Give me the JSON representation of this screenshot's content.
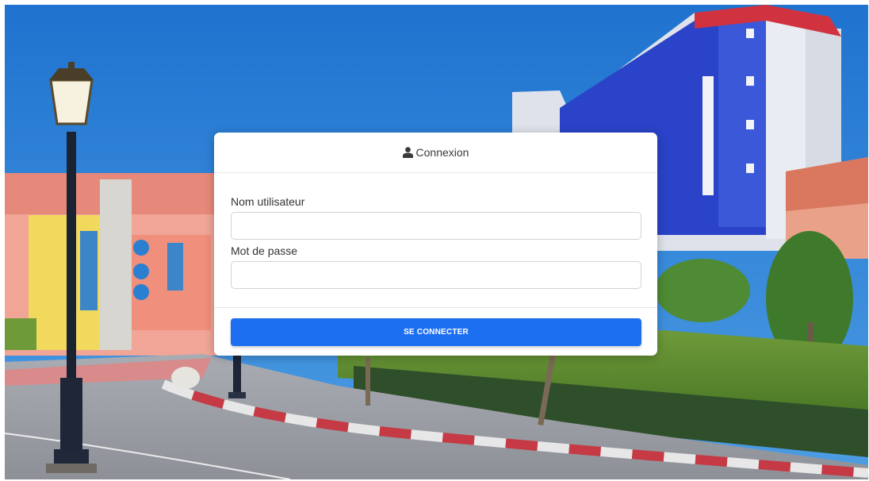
{
  "login": {
    "title": "Connexion",
    "title_icon": "user-icon",
    "username_label": "Nom utilisateur",
    "username_value": "",
    "password_label": "Mot de passe",
    "password_value": "",
    "submit_label": "SE CONNECTER"
  },
  "colors": {
    "primary_button": "#1d6ff2",
    "card_background": "#ffffff",
    "sky": "#2f86d8"
  }
}
